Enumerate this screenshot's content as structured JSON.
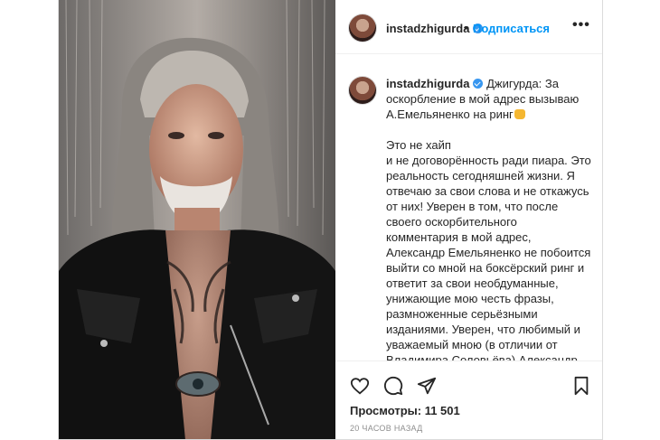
{
  "post": {
    "username": "instadzhigurda",
    "follow_label": "Подписаться",
    "dot": "•",
    "more_label": "•••",
    "caption_head": " Джигурда: За оскорбление в мой адрес вызываю А.Емельяненко на ринг",
    "caption_body": "Это не хайп\nи не договорённость ради пиара. Это реальность сегодняшней жизни. Я отвечаю за свои слова и не откажусь от них! Уверен в том, что после своего оскорбительного комментария в мой адрес, Александр Емельяненко не побоится выйти со мной на боксёрский ринг и ответит за свои необдуманные, унижающие мою честь фразы, размноженные серьёзными изданиями. Уверен, что любимый и уважаемый мною (в отличии от Владимира Соловьёва) Александр Емельяненко не такой же",
    "views": "Просмотры: 11 501",
    "time": "20 часов назад"
  },
  "icons": {
    "like": "heart-icon",
    "comment": "comment-icon",
    "share": "paper-plane-icon",
    "save": "bookmark-icon",
    "verified": "verified-badge-icon"
  },
  "colors": {
    "follow": "#0095f6",
    "verified": "#3897f0",
    "muted": "#8e8e8e"
  }
}
